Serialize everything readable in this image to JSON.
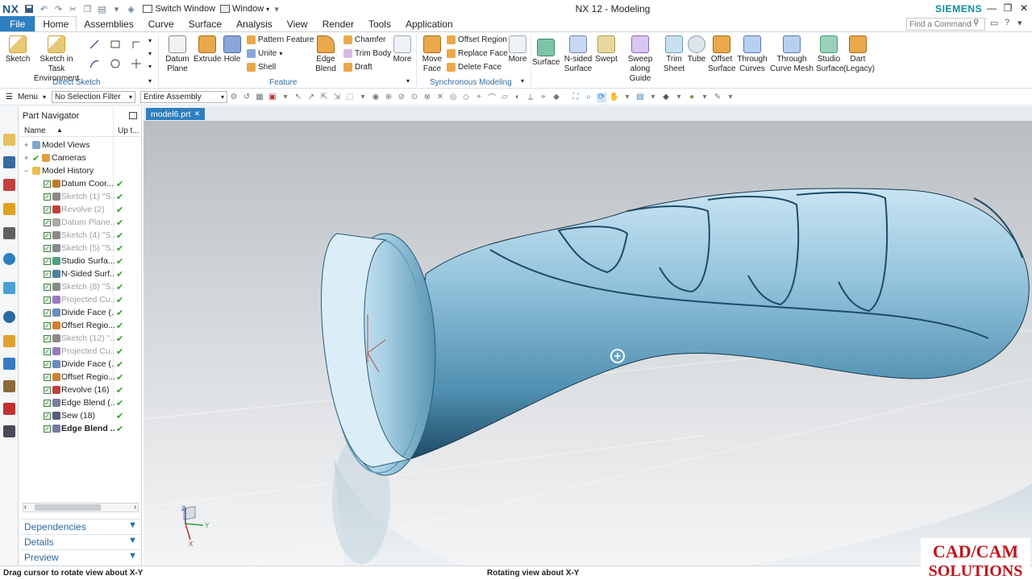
{
  "app": {
    "logo": "NX",
    "title": "NX 12 - Modeling",
    "brand": "SIEMENS",
    "switch_window": "Switch Window",
    "window_menu": "Window"
  },
  "tabs": [
    "File",
    "Home",
    "Assemblies",
    "Curve",
    "Surface",
    "Analysis",
    "View",
    "Render",
    "Tools",
    "Application"
  ],
  "command_finder": {
    "placeholder": "Find a Command"
  },
  "ribbon": {
    "direct_sketch": {
      "label": "Direct Sketch",
      "sketch": "Sketch",
      "sketch_task": "Sketch in Task Environment"
    },
    "feature": {
      "label": "Feature",
      "datum_plane": "Datum Plane",
      "extrude": "Extrude",
      "hole": "Hole",
      "pattern_feature": "Pattern Feature",
      "unite": "Unite",
      "shell": "Shell",
      "edge_blend": "Edge Blend",
      "chamfer": "Chamfer",
      "trim_body": "Trim Body",
      "draft": "Draft",
      "more": "More"
    },
    "sync": {
      "label": "Synchronous Modeling",
      "move_face": "Move Face",
      "offset_region": "Offset Region",
      "replace_face": "Replace Face",
      "delete_face": "Delete Face",
      "more": "More"
    },
    "surface": {
      "surface": "Surface",
      "n_sided": "N-sided Surface",
      "swept": "Swept",
      "sweep_guide": "Sweep along Guide",
      "trim_sheet": "Trim Sheet",
      "tube": "Tube",
      "offset_surface": "Offset Surface",
      "through_curves": "Through Curves",
      "through_curve_mesh": "Through Curve Mesh",
      "studio_surface": "Studio Surface",
      "dart": "Dart (Legacy)"
    }
  },
  "toolbar": {
    "menu": "Menu",
    "selection_filter": "No Selection Filter",
    "assembly_scope": "Entire Assembly"
  },
  "navigator": {
    "title": "Part Navigator",
    "col_name": "Name",
    "col_up": "Up t...",
    "items": [
      {
        "label": "Model Views",
        "level": 0,
        "style": "normal"
      },
      {
        "label": "Cameras",
        "level": 0,
        "style": "normal"
      },
      {
        "label": "Model History",
        "level": 0,
        "style": "normal"
      },
      {
        "label": "Datum Coor...",
        "level": 1,
        "style": "normal"
      },
      {
        "label": "Sketch (1) \"S...",
        "level": 1,
        "style": "muted"
      },
      {
        "label": "Revolve (2)",
        "level": 1,
        "style": "muted"
      },
      {
        "label": "Datum Plane...",
        "level": 1,
        "style": "muted"
      },
      {
        "label": "Sketch (4) \"S...",
        "level": 1,
        "style": "muted"
      },
      {
        "label": "Sketch (5) \"S...",
        "level": 1,
        "style": "muted"
      },
      {
        "label": "Studio Surfa...",
        "level": 1,
        "style": "normal"
      },
      {
        "label": "N-Sided Surf...",
        "level": 1,
        "style": "normal"
      },
      {
        "label": "Sketch (8) \"S...",
        "level": 1,
        "style": "muted"
      },
      {
        "label": "Projected Cu...",
        "level": 1,
        "style": "muted"
      },
      {
        "label": "Divide Face (...",
        "level": 1,
        "style": "normal"
      },
      {
        "label": "Offset Regio...",
        "level": 1,
        "style": "normal"
      },
      {
        "label": "Sketch (12) \"...",
        "level": 1,
        "style": "muted"
      },
      {
        "label": "Projected Cu...",
        "level": 1,
        "style": "muted"
      },
      {
        "label": "Divide Face (...",
        "level": 1,
        "style": "normal"
      },
      {
        "label": "Offset Regio...",
        "level": 1,
        "style": "normal"
      },
      {
        "label": "Revolve (16)",
        "level": 1,
        "style": "normal"
      },
      {
        "label": "Edge Blend (...",
        "level": 1,
        "style": "normal"
      },
      {
        "label": "Sew (18)",
        "level": 1,
        "style": "normal"
      },
      {
        "label": "Edge Blend ...",
        "level": 1,
        "style": "bold"
      }
    ],
    "panels": [
      "Dependencies",
      "Details",
      "Preview"
    ]
  },
  "document_tab": "model6.prt",
  "status": {
    "left": "Drag cursor to rotate view about X-Y",
    "mid": "Rotating view about X-Y"
  },
  "watermark": {
    "line1": "CAD/CAM",
    "line2": "SOLUTIONS"
  },
  "triad": {
    "x": "X",
    "y": "Y",
    "z": "Z"
  },
  "colors": {
    "accent": "#2e7fbf",
    "brand": "#0b8e9a",
    "model": "#8fbdd6",
    "ok_green": "#2aa02a",
    "watermark_red": "#c0141c"
  }
}
